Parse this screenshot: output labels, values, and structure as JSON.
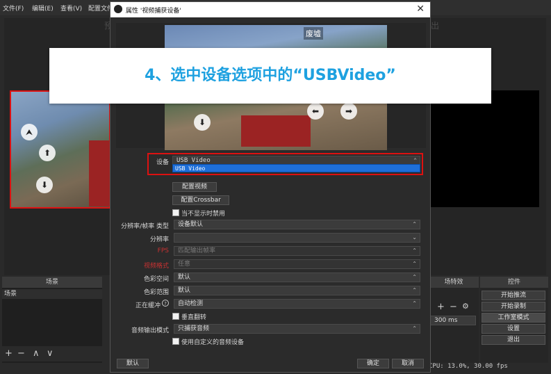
{
  "menubar": {
    "items": [
      "文件(F)",
      "编辑(E)",
      "查看(V)",
      "配置文件"
    ]
  },
  "dialog": {
    "title": "属性 '视频捕获设备'",
    "close": "✕",
    "preview_overlay": "废墟",
    "form": {
      "device_label": "设备",
      "device_value": "USB Video",
      "device_dropdown_option": "USB Video",
      "btn_configure_video": "配置视频",
      "btn_configure_crossbar": "配置Crossbar",
      "deactivate_when_hidden": "当不显示时禁用",
      "resolution_fps_type_label": "分辨率/帧率 类型",
      "resolution_fps_type_value": "设备默认",
      "resolution_label": "分辨率",
      "resolution_value": "",
      "fps_label": "FPS",
      "fps_value": "匹配输出帧率",
      "video_format_label": "视频格式",
      "video_format_value": "任意",
      "color_space_label": "色彩空间",
      "color_space_value": "默认",
      "color_range_label": "色彩范围",
      "color_range_value": "默认",
      "buffering_label": "正在缓冲",
      "buffering_value": "自动检测",
      "flip_vertical": "垂直翻转",
      "audio_output_mode_label": "音频输出模式",
      "audio_output_mode_value": "只捕获音频",
      "use_custom_audio": "使用自定义的音频设备"
    },
    "footer": {
      "defaults": "默认",
      "ok": "确定",
      "cancel": "取消"
    }
  },
  "banner": {
    "text": "4、选中设备选项中的“USBVideo”",
    "color": "#1ea1e0"
  },
  "docks": {
    "scenes_title": "场景",
    "scene_item": "场景",
    "controls_title": "控件",
    "transitions_title": "场特效",
    "transition_duration": "300 ms",
    "controls": [
      "开始推流",
      "开始录制",
      "工作室模式",
      "设置",
      "退出"
    ]
  },
  "preview_labels": {
    "left": "预",
    "right": "出"
  },
  "status": {
    "text": "CPU: 13.0%, 30.00 fps"
  },
  "colors": {
    "highlight": "#dd1111",
    "dropdown_selected": "#1e6fd9"
  }
}
